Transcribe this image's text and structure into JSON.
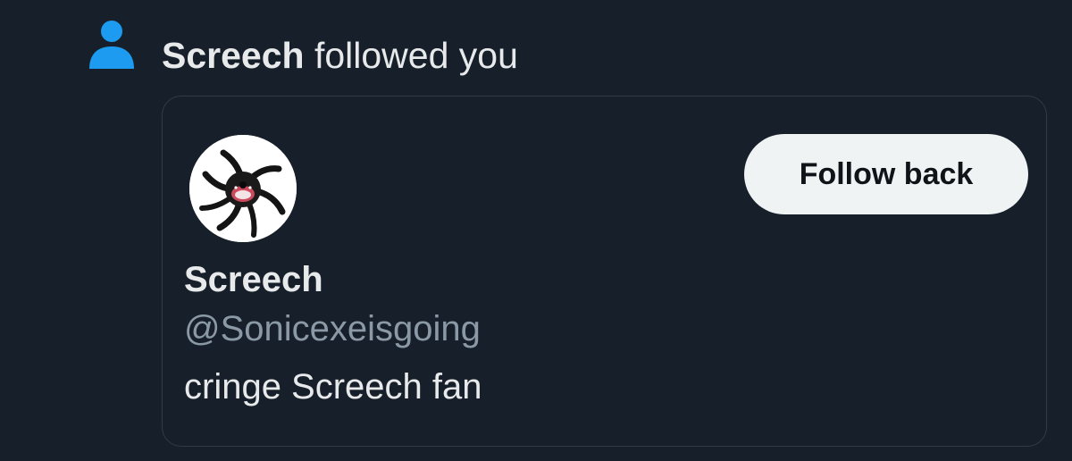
{
  "notification": {
    "icon": "person-icon",
    "actor_name": "Screech",
    "action_text": " followed you",
    "accent_color": "#1d9bf0"
  },
  "card": {
    "avatar_icon": "screech-avatar-icon",
    "follow_button_label": "Follow back",
    "display_name": "Screech",
    "handle": "@Sonicexeisgoing",
    "bio": "cringe Screech fan"
  }
}
